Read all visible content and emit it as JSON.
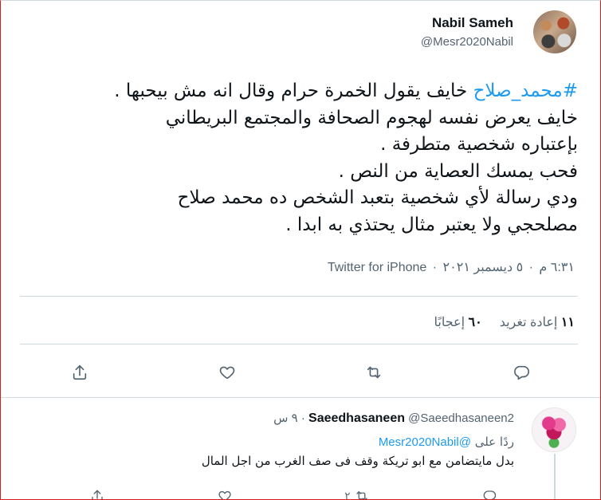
{
  "tweet": {
    "author_name": "Nabil Sameh",
    "author_handle": "@Mesr2020Nabil",
    "hashtag": "#محمد_صلاح",
    "line1_rest": " خايف يقول الخمرة حرام وقال انه مش بيحبها .",
    "line2": "خايف يعرض نفسه لهجوم الصحافة والمجتمع البريطاني",
    "line3": "بإعتباره شخصية متطرفة .",
    "line4": "فحب يمسك العصاية من النص .",
    "line5": "ودي رسالة لأي شخصية بتعبد الشخص ده محمد صلاح",
    "line6": "مصلحجي ولا يعتبر مثال يحتذي به ابدا .",
    "time": "٦:٣١ م",
    "date": "٥ ديسمبر ٢٠٢١",
    "source": "Twitter for iPhone",
    "separator": "·"
  },
  "stats": {
    "retweets_count": "١١",
    "retweets_label": "إعادة تغريد",
    "likes_count": "٦٠",
    "likes_label": "إعجابًا"
  },
  "actions": {
    "icons": [
      "reply-icon",
      "retweet-icon",
      "like-icon",
      "share-icon"
    ]
  },
  "reply": {
    "author_name": "Saeedhasaneen",
    "author_handle": "@Saeedhasaneen2",
    "time": "٩ س",
    "separator": "·",
    "replying_label": "ردًا على",
    "replying_to": "@Mesr2020Nabil",
    "text": "بدل مايتضامن مع ابو تريكة وقف فى صف الغرب من اجل المال",
    "retweet_count": "٢"
  }
}
